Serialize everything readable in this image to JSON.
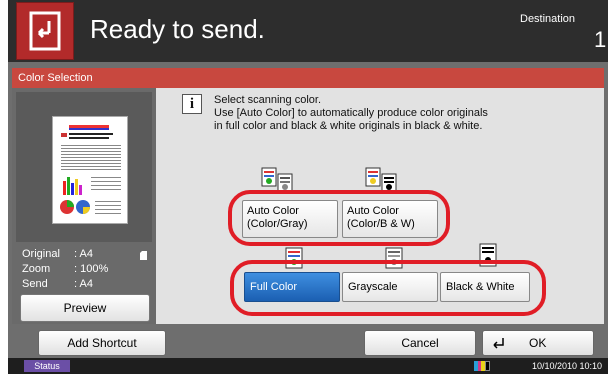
{
  "header": {
    "title": "Ready to send.",
    "destination_label": "Destination",
    "destination_count": "1"
  },
  "panel": {
    "title": "Color Selection"
  },
  "preview": {
    "info": [
      {
        "key": "Original",
        "value": ": A4"
      },
      {
        "key": "Zoom",
        "value": ": 100%"
      },
      {
        "key": "Send",
        "value": ": A4"
      }
    ],
    "preview_button": "Preview"
  },
  "instructions": {
    "line1": "Select scanning color.",
    "line2": "Use [Auto Color] to automatically produce color originals",
    "line3": "in full color and black & white originals in black & white."
  },
  "options": {
    "auto_color_gray": {
      "line1": "Auto Color",
      "line2": "(Color/Gray)"
    },
    "auto_color_bw": {
      "line1": "Auto Color",
      "line2": "(Color/B & W)"
    },
    "full_color": "Full Color",
    "grayscale": "Grayscale",
    "black_white": "Black & White",
    "selected": "Full Color"
  },
  "bottom": {
    "add_shortcut": "Add Shortcut",
    "cancel": "Cancel",
    "ok": "OK"
  },
  "status": {
    "status_label": "Status",
    "datetime": "10/10/2010  10:10"
  },
  "colors": {
    "accent_red": "#e01d26",
    "header_red": "#c8483f",
    "home_red": "#b22a2a",
    "selected_blue": "#1b5fb2"
  },
  "icons": {
    "home": "home-return-icon",
    "info": "info-icon",
    "enter": "enter-arrow-icon",
    "paper": "paper-orientation-icon"
  }
}
